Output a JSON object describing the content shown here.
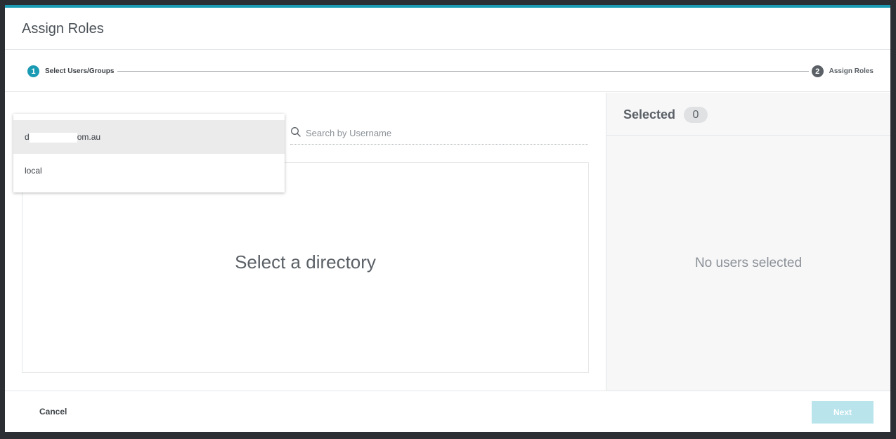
{
  "modal": {
    "title": "Assign Roles"
  },
  "stepper": {
    "steps": [
      {
        "number": "1",
        "label": "Select Users/Groups",
        "state": "active"
      },
      {
        "number": "2",
        "label": "Assign Roles",
        "state": "inactive"
      }
    ]
  },
  "directory_dropdown": {
    "items": [
      {
        "label_start": "d",
        "label_end": "om.au",
        "highlighted": true
      },
      {
        "label": "local",
        "highlighted": false
      }
    ]
  },
  "search": {
    "placeholder": "Search by Username",
    "value": "",
    "icon": "search-icon"
  },
  "results": {
    "empty_message": "Select a directory"
  },
  "selected_panel": {
    "title": "Selected",
    "count": "0",
    "empty_message": "No users selected"
  },
  "footer": {
    "cancel_label": "Cancel",
    "next_label": "Next"
  },
  "colors": {
    "accent": "#1a9bb3",
    "next_disabled": "#b9e4ec",
    "backdrop": "#2b2f33"
  }
}
